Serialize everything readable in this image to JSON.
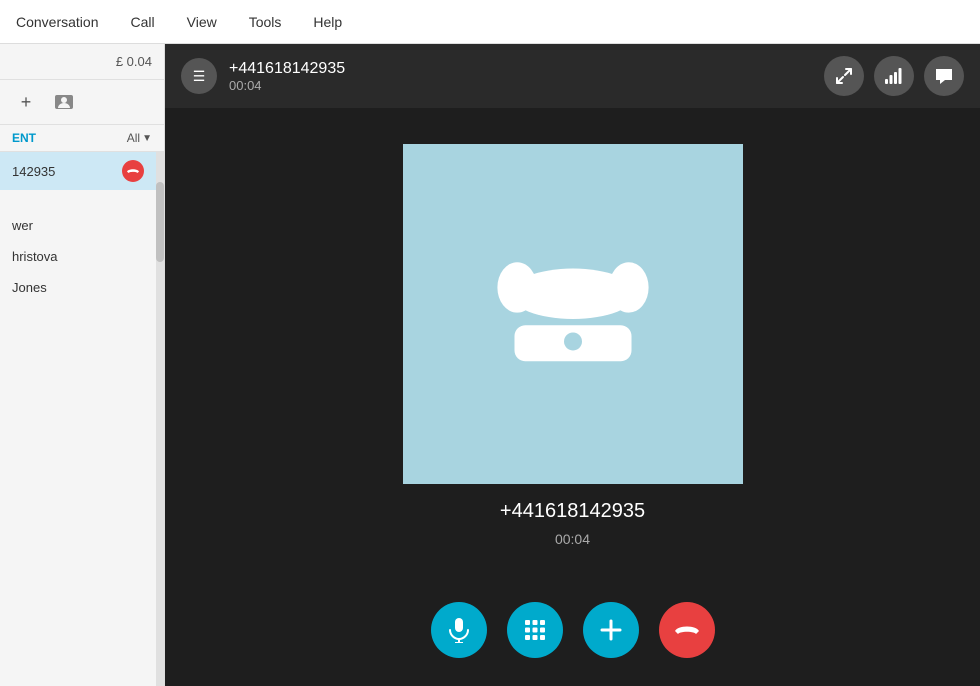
{
  "menu": {
    "items": [
      "Conversation",
      "Call",
      "View",
      "Tools",
      "Help"
    ]
  },
  "sidebar": {
    "balance": "£ 0.04",
    "filter_label": "ENT",
    "filter_dropdown": "All",
    "active_contact_number": "142935",
    "contacts": [
      {
        "name": "wer"
      },
      {
        "name": "hristova"
      },
      {
        "name": "Jones"
      }
    ],
    "add_icon": "+",
    "contacts_icon": "👤"
  },
  "call": {
    "header": {
      "number": "+441618142935",
      "timer": "00:04",
      "list_icon": "☰",
      "expand_icon": "⤢",
      "signal_icon": "📶",
      "chat_icon": "💬"
    },
    "center": {
      "number": "+441618142935",
      "timer": "00:04"
    },
    "controls": {
      "mic_label": "Microphone",
      "dialpad_label": "Dialpad",
      "add_label": "Add",
      "end_label": "End call"
    }
  }
}
